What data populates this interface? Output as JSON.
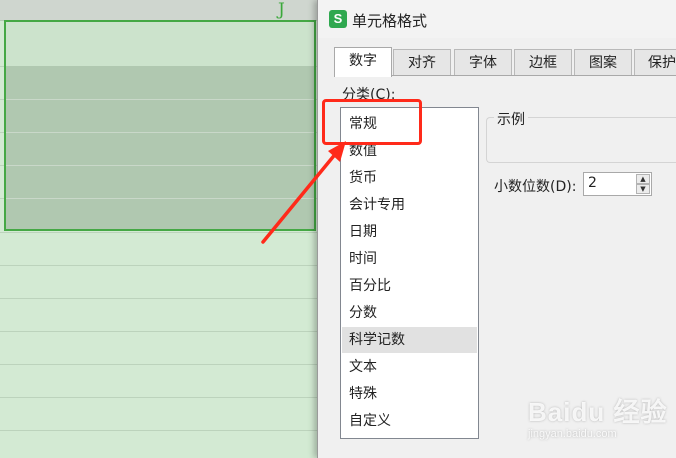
{
  "sheet": {
    "column_label": "J"
  },
  "dialog": {
    "icon_letter": "S",
    "title": "单元格格式",
    "tabs": [
      {
        "label": "数字",
        "active": true
      },
      {
        "label": "对齐"
      },
      {
        "label": "字体"
      },
      {
        "label": "边框"
      },
      {
        "label": "图案"
      },
      {
        "label": "保护"
      }
    ],
    "category_label": "分类(C):",
    "categories": [
      "常规",
      "数值",
      "货币",
      "会计专用",
      "日期",
      "时间",
      "百分比",
      "分数",
      "科学记数",
      "文本",
      "特殊",
      "自定义"
    ],
    "selected_category": "科学记数",
    "sample_label": "示例",
    "decimal_label": "小数位数(D):",
    "decimal_value": "2"
  },
  "annotation": {
    "color": "#ff2a1a",
    "highlighted_item": "常规"
  },
  "watermark": {
    "main": "Baidu 经验",
    "sub": "jingyan.baidu.com"
  }
}
